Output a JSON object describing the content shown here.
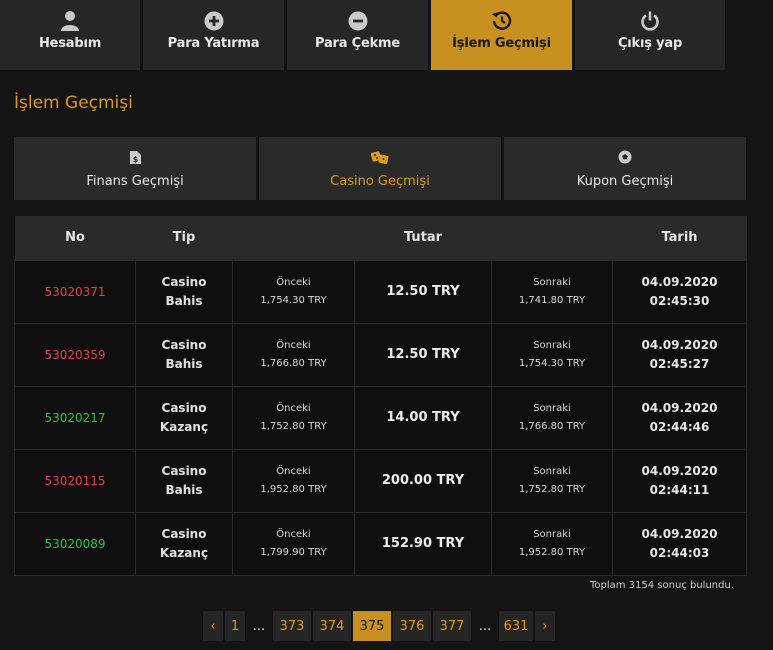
{
  "nav": {
    "tabs": [
      {
        "label": "Hesabım",
        "icon": "user-icon",
        "active": false
      },
      {
        "label": "Para Yatırma",
        "icon": "plus-circle-icon",
        "active": false
      },
      {
        "label": "Para Çekme",
        "icon": "minus-circle-icon",
        "active": false
      },
      {
        "label": "İşlem Geçmişi",
        "icon": "history-icon",
        "active": true
      },
      {
        "label": "Çıkış yap",
        "icon": "power-icon",
        "active": false
      }
    ]
  },
  "page": {
    "title": "İşlem Geçmişi"
  },
  "subtabs": [
    {
      "label": "Finans Geçmişi",
      "icon": "money-file-icon",
      "active": false
    },
    {
      "label": "Casino Geçmişi",
      "icon": "dice-icon",
      "active": true
    },
    {
      "label": "Kupon Geçmişi",
      "icon": "soccer-ball-icon",
      "active": false
    }
  ],
  "table": {
    "headers": {
      "no": "No",
      "tip": "Tip",
      "tutar": "Tutar",
      "tarih": "Tarih"
    },
    "rows": [
      {
        "no": "53020371",
        "status": "loss",
        "tip1": "Casino",
        "tip2": "Bahis",
        "before_label": "Önceki",
        "before": "1,754.30 TRY",
        "amount": "12.50 TRY",
        "after_label": "Sonraki",
        "after": "1,741.80 TRY",
        "date": "04.09.2020",
        "time": "02:45:30"
      },
      {
        "no": "53020359",
        "status": "loss",
        "tip1": "Casino",
        "tip2": "Bahis",
        "before_label": "Önceki",
        "before": "1,766.80 TRY",
        "amount": "12.50 TRY",
        "after_label": "Sonraki",
        "after": "1,754.30 TRY",
        "date": "04.09.2020",
        "time": "02:45:27"
      },
      {
        "no": "53020217",
        "status": "win",
        "tip1": "Casino",
        "tip2": "Kazanç",
        "before_label": "Önceki",
        "before": "1,752.80 TRY",
        "amount": "14.00 TRY",
        "after_label": "Sonraki",
        "after": "1,766.80 TRY",
        "date": "04.09.2020",
        "time": "02:44:46"
      },
      {
        "no": "53020115",
        "status": "loss",
        "tip1": "Casino",
        "tip2": "Bahis",
        "before_label": "Önceki",
        "before": "1,952.80 TRY",
        "amount": "200.00 TRY",
        "after_label": "Sonraki",
        "after": "1,752.80 TRY",
        "date": "04.09.2020",
        "time": "02:44:11"
      },
      {
        "no": "53020089",
        "status": "win",
        "tip1": "Casino",
        "tip2": "Kazanç",
        "before_label": "Önceki",
        "before": "1,799.90 TRY",
        "amount": "152.90 TRY",
        "after_label": "Sonraki",
        "after": "1,952.80 TRY",
        "date": "04.09.2020",
        "time": "02:44:03"
      }
    ]
  },
  "total_text": "Toplam 3154 sonuç bulundu.",
  "pagination": {
    "prev": "‹",
    "next": "›",
    "items": [
      {
        "label": "1",
        "type": "page"
      },
      {
        "label": "...",
        "type": "dots"
      },
      {
        "label": "373",
        "type": "page"
      },
      {
        "label": "374",
        "type": "page"
      },
      {
        "label": "375",
        "type": "active"
      },
      {
        "label": "376",
        "type": "page"
      },
      {
        "label": "377",
        "type": "page"
      },
      {
        "label": "...",
        "type": "dots"
      },
      {
        "label": "631",
        "type": "page"
      }
    ]
  },
  "colors": {
    "accent": "#c8901e",
    "loss": "#e0424a",
    "win": "#2fbf4a"
  }
}
